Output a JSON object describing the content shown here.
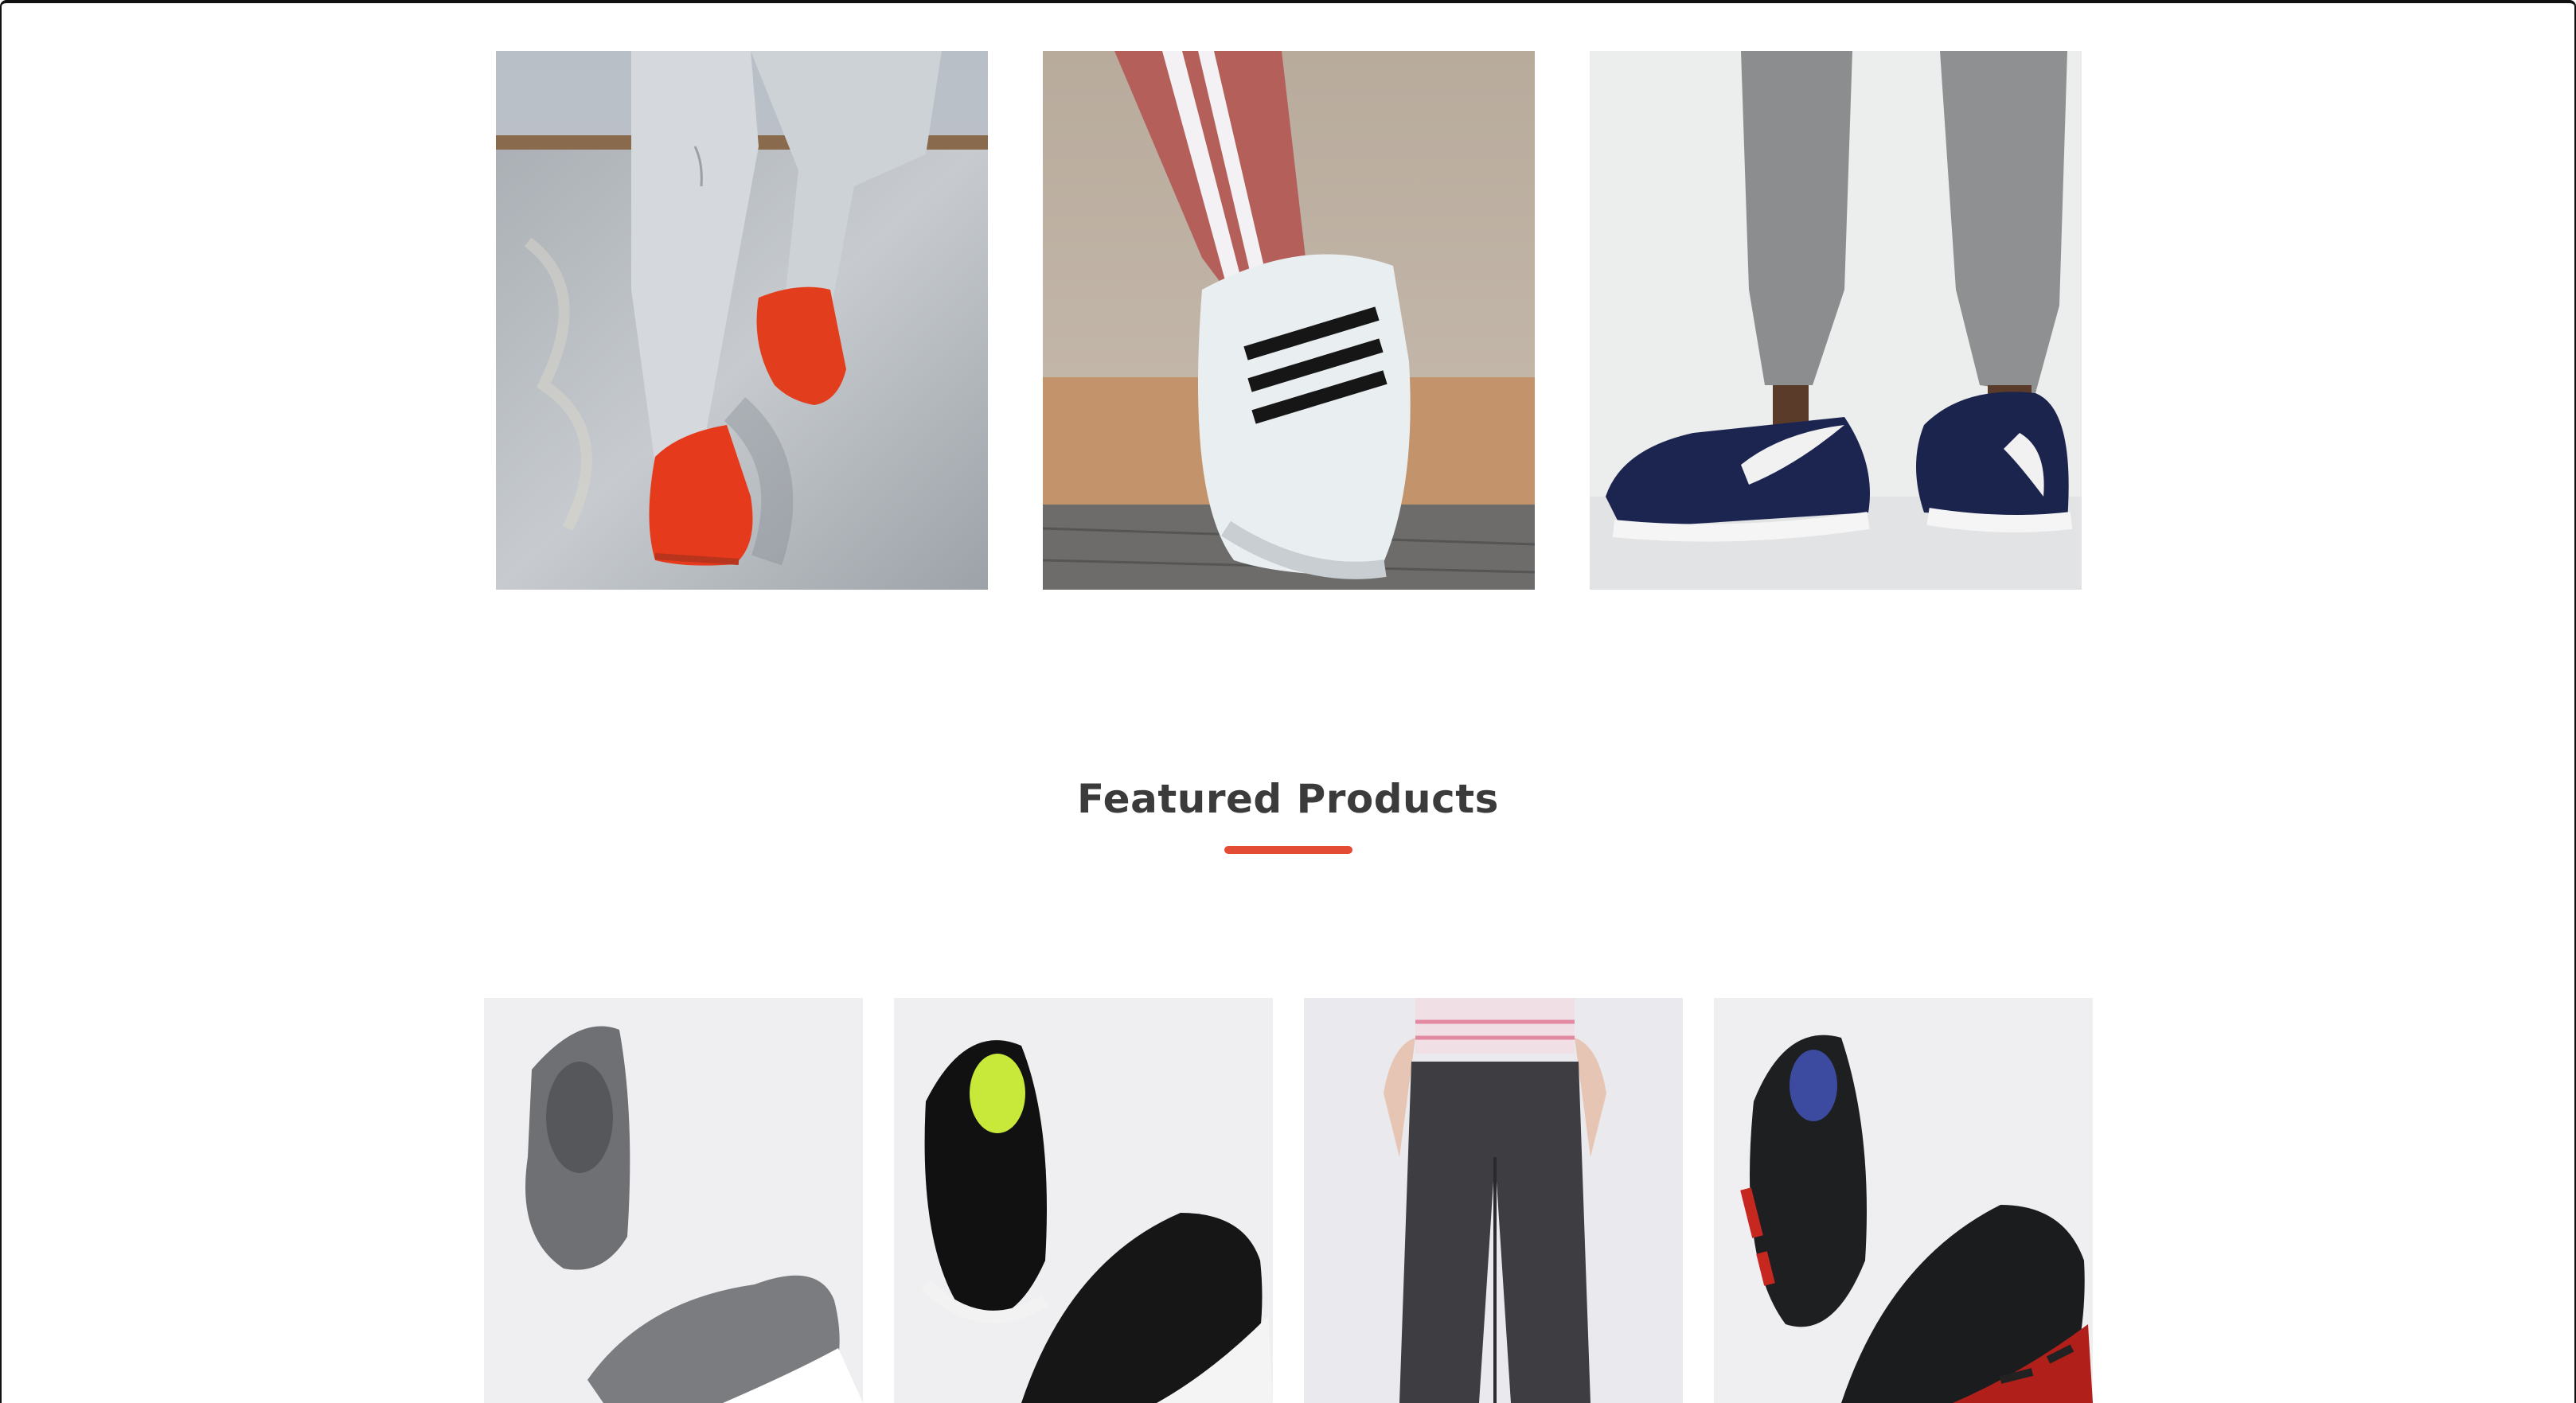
{
  "featured": {
    "title": "Featured Products"
  },
  "banners": [
    {
      "alt": "Red sneakers on a concrete ledge"
    },
    {
      "alt": "White striped sneaker"
    },
    {
      "alt": "Navy running shoes"
    }
  ],
  "products": [
    {
      "alt": "Grey slip-on sneaker"
    },
    {
      "alt": "Black HRX running shoe"
    },
    {
      "alt": "Charcoal jogger pants"
    },
    {
      "alt": "Black and red running shoe"
    }
  ],
  "colors": {
    "accent": "#e44b35",
    "title": "#3b3b3b"
  }
}
